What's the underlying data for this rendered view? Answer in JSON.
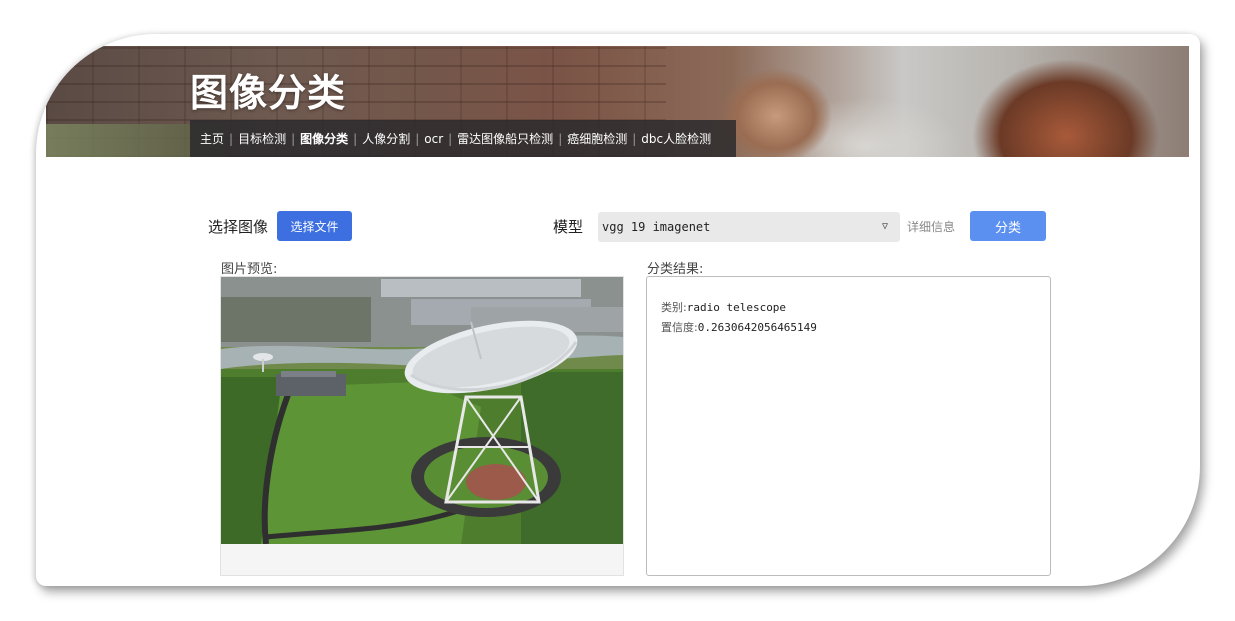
{
  "header": {
    "title": "图像分类",
    "nav": [
      {
        "label": "主页",
        "active": false
      },
      {
        "label": "目标检测",
        "active": false
      },
      {
        "label": "图像分类",
        "active": true
      },
      {
        "label": "人像分割",
        "active": false
      },
      {
        "label": "ocr",
        "active": false
      },
      {
        "label": "雷达图像船只检测",
        "active": false
      },
      {
        "label": "癌细胞检测",
        "active": false
      },
      {
        "label": "dbc人脸检测",
        "active": false
      }
    ]
  },
  "controls": {
    "choose_image_label": "选择图像",
    "choose_file_button": "选择文件",
    "model_label": "模型",
    "model_selected": "vgg 19 imagenet",
    "details_link": "详细信息",
    "classify_button": "分类"
  },
  "preview": {
    "label": "图片预览:"
  },
  "result": {
    "label": "分类结果:",
    "category_key": "类别:",
    "category_value": "radio telescope",
    "confidence_key": "置信度:",
    "confidence_value": "0.2630642056465149"
  },
  "icons": {
    "select_caret": "chevron-down-icon"
  },
  "colors": {
    "primary_button": "#3d6fe0",
    "classify_button": "#5b8ff0",
    "nav_bar": "#28282c"
  }
}
